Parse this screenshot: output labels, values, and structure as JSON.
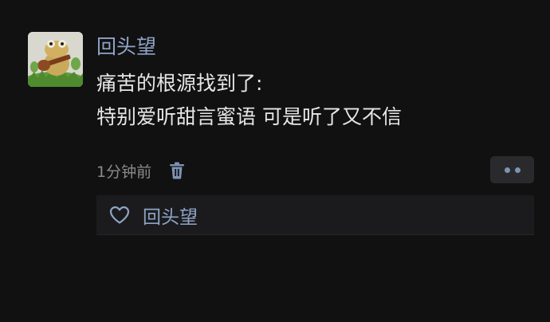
{
  "post": {
    "author": "回头望",
    "avatar_icon": "frog-with-guitar-avatar",
    "lines": [
      "痛苦的根源找到了:",
      "特别爱听甜言蜜语 可是听了又不信"
    ],
    "timestamp": "1分钟前"
  },
  "likes": {
    "names": "回头望"
  },
  "colors": {
    "background": "#111112",
    "name_link": "#8fa4c6",
    "text": "#e6e6e6",
    "meta": "#8a8a8a",
    "panel": "#1b1b1d"
  },
  "icons": {
    "delete": "trash-icon",
    "more": "more-dots-icon",
    "like": "heart-outline-icon"
  }
}
